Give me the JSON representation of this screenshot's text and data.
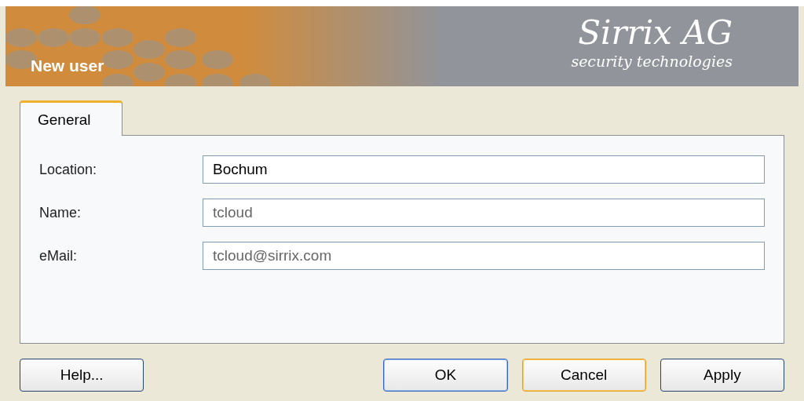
{
  "window": {
    "title": "New user"
  },
  "logo": {
    "name": "Sirrix AG",
    "tagline": "security technologies"
  },
  "tabs": [
    {
      "label": "General",
      "selected": true
    }
  ],
  "fields": [
    {
      "label": "Location:",
      "value": "Bochum",
      "disabled": false
    },
    {
      "label": "Name:",
      "value": "tcloud",
      "disabled": true
    },
    {
      "label": "eMail:",
      "value": "tcloud@sirrix.com",
      "disabled": true
    }
  ],
  "buttons": [
    {
      "label": "Help...",
      "default": false,
      "focused": false
    },
    {
      "label": "OK",
      "default": true,
      "focused": false
    },
    {
      "label": "Cancel",
      "default": false,
      "focused": true
    },
    {
      "label": "Apply",
      "default": false,
      "focused": false
    }
  ]
}
